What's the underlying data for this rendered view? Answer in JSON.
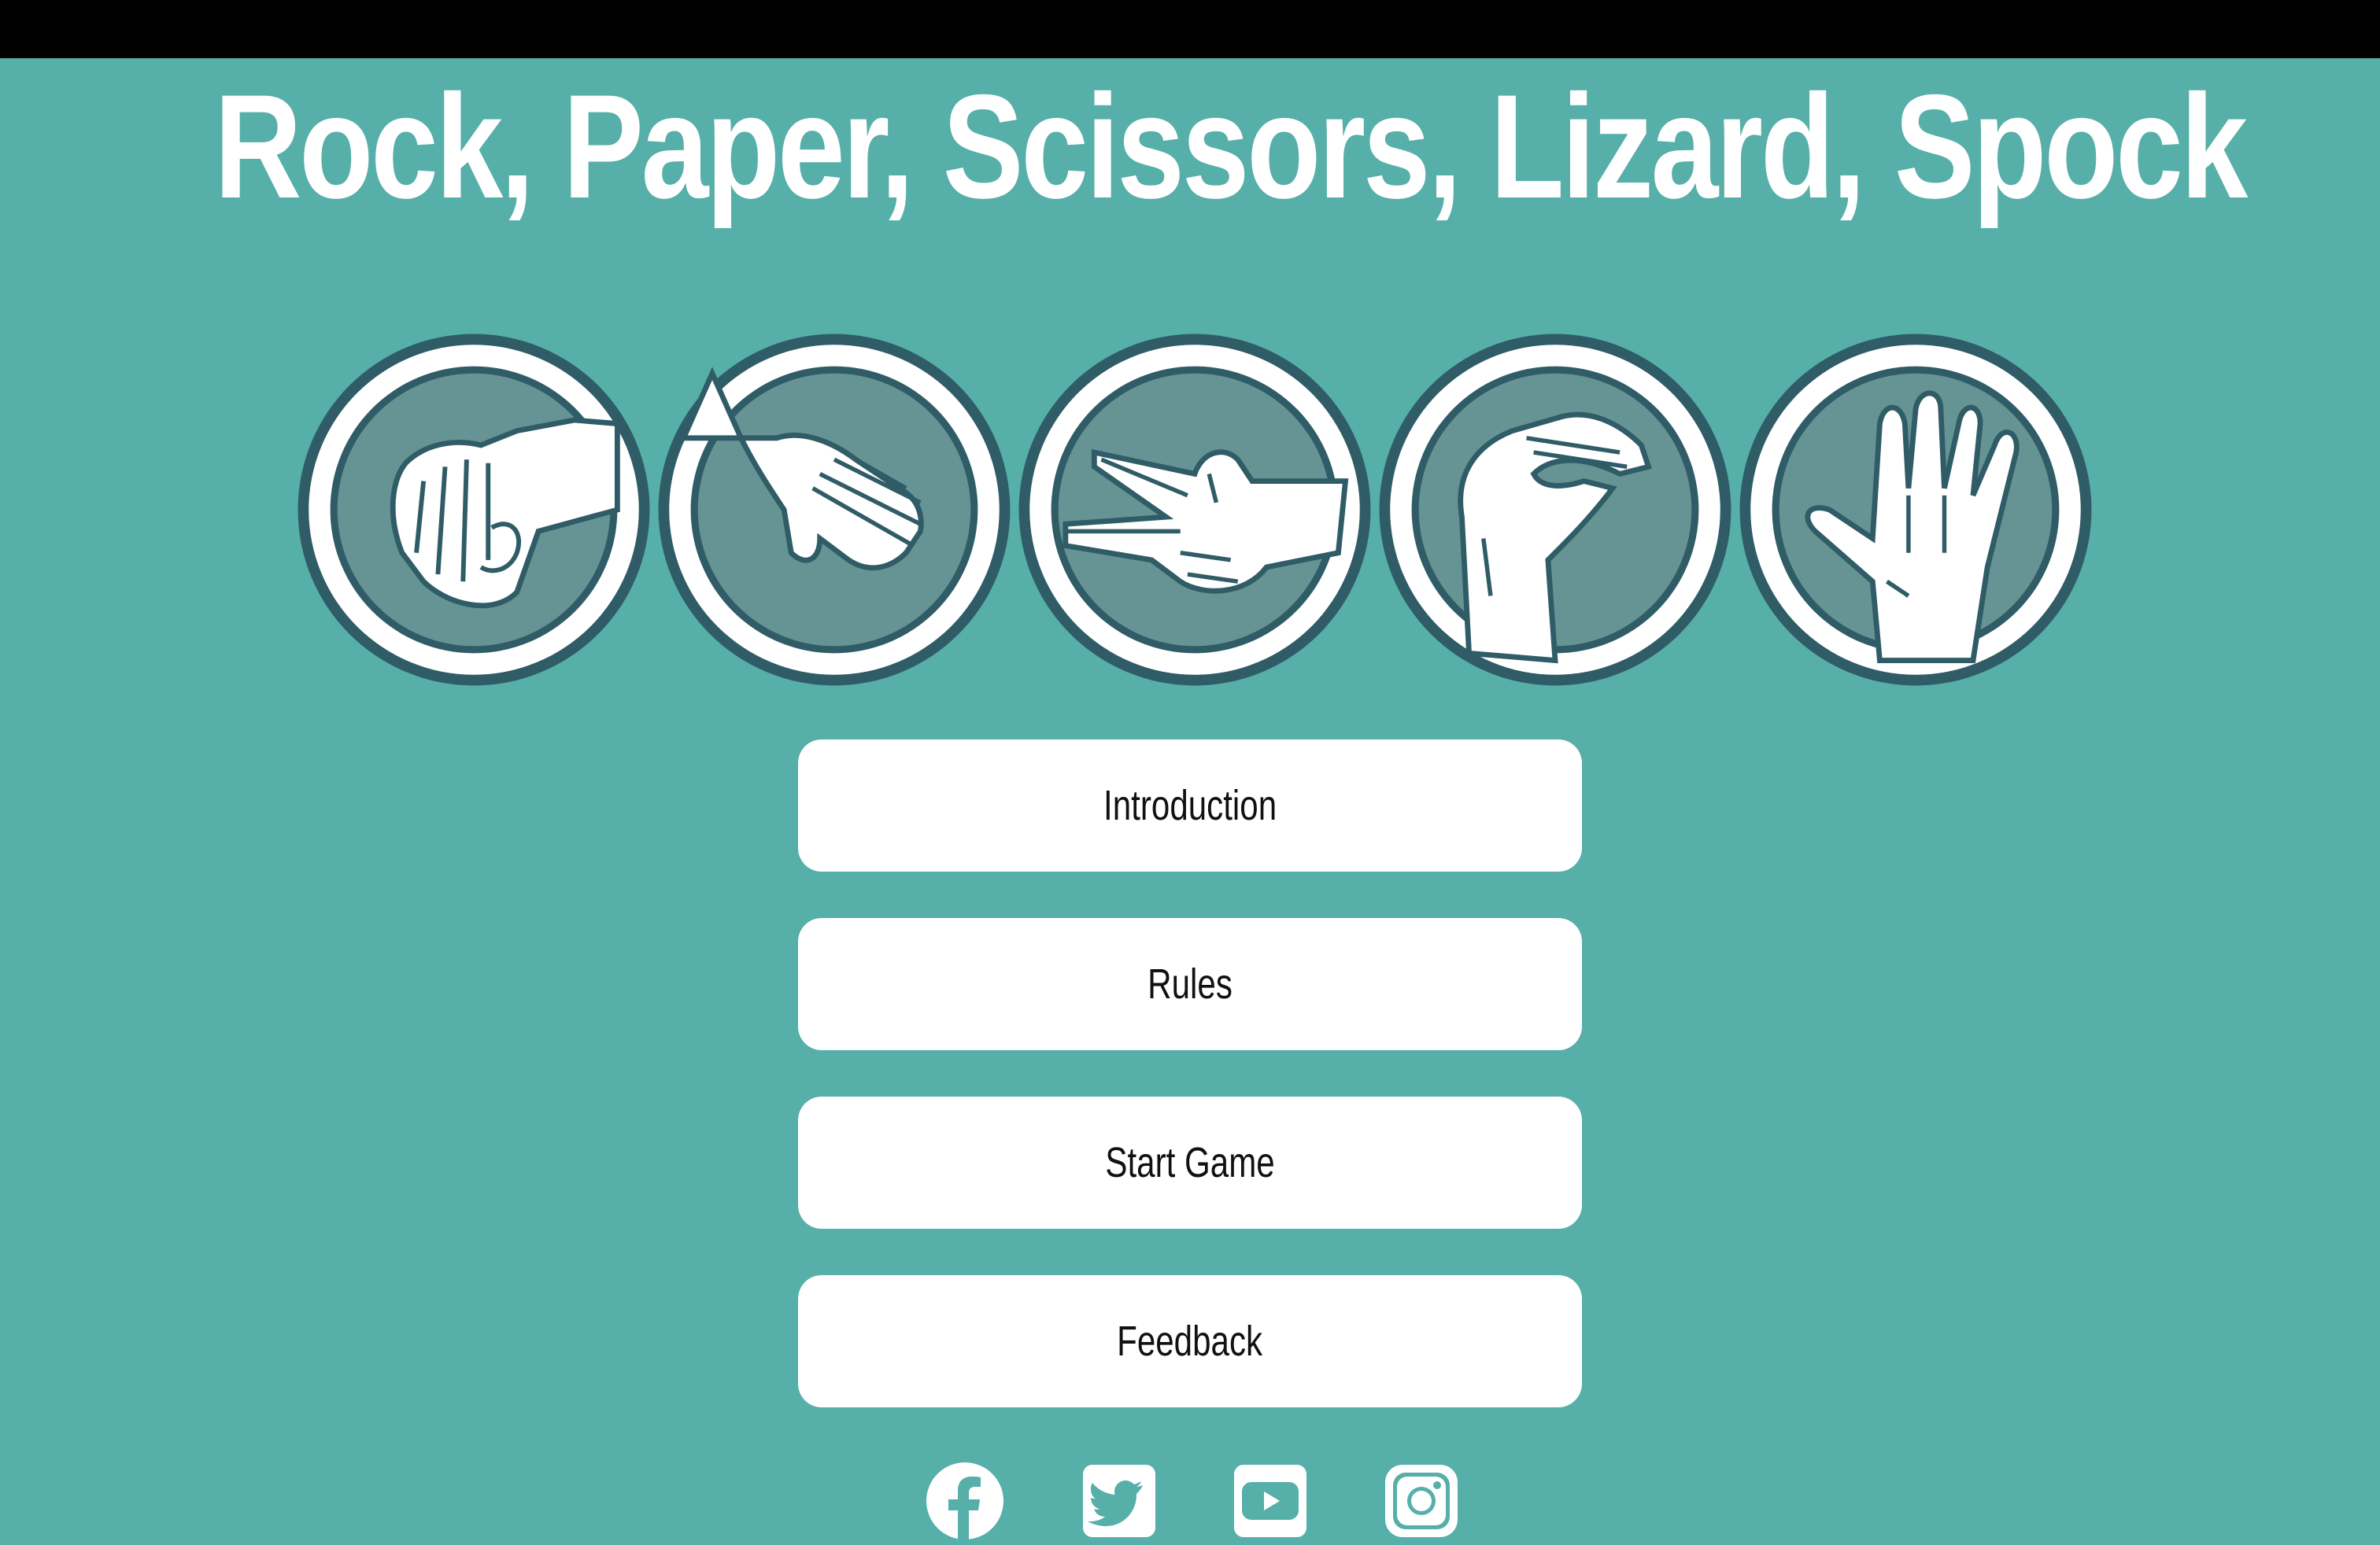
{
  "header": {
    "title": "Rock, Paper, Scissors, Lizard, Spock"
  },
  "gestures": [
    {
      "name": "rock",
      "icon": "rock-fist-icon"
    },
    {
      "name": "paper",
      "icon": "paper-hand-icon"
    },
    {
      "name": "scissors",
      "icon": "scissors-fingers-icon"
    },
    {
      "name": "lizard",
      "icon": "lizard-hand-icon"
    },
    {
      "name": "spock",
      "icon": "spock-salute-icon"
    }
  ],
  "menu": {
    "introduction_label": "Introduction",
    "rules_label": "Rules",
    "start_game_label": "Start Game",
    "feedback_label": "Feedback"
  },
  "social": [
    {
      "icon": "facebook-icon"
    },
    {
      "icon": "twitter-icon"
    },
    {
      "icon": "youtube-icon"
    },
    {
      "icon": "instagram-icon"
    }
  ],
  "colors": {
    "background": "#56afa8",
    "top_bar": "#000000",
    "icon_ring": "#2f5c66",
    "icon_inner": "#669494",
    "button_bg": "#ffffff",
    "button_text": "#111111",
    "title_text": "#ffffff"
  }
}
